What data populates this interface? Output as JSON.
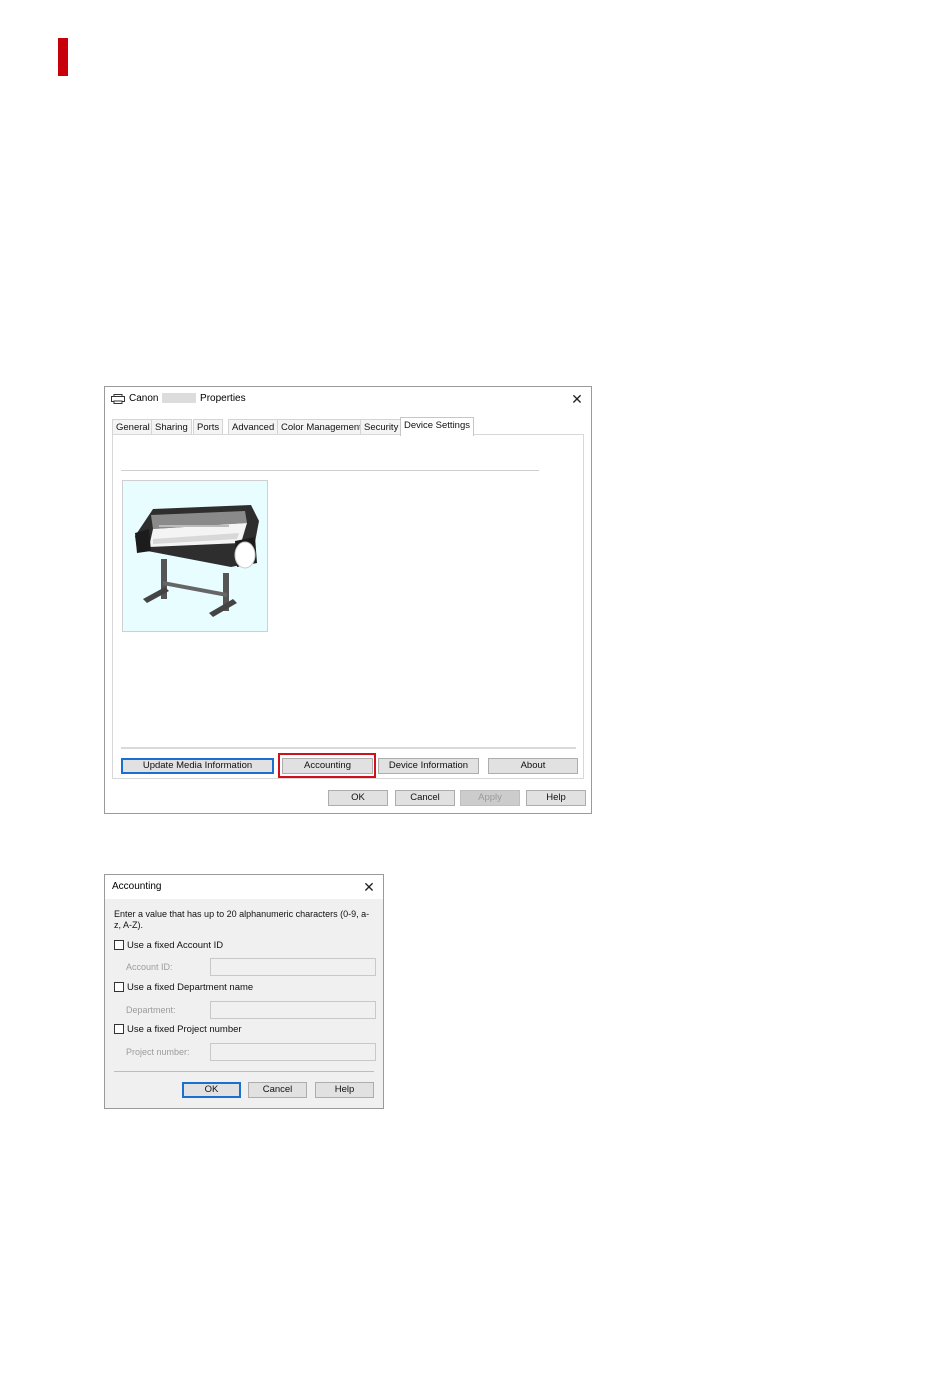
{
  "marker_color": "#c8000b",
  "properties_window": {
    "title_prefix": "Canon",
    "title_suffix": "Properties",
    "tabs": [
      "General",
      "Sharing",
      "Ports",
      "Advanced",
      "Color Management",
      "Security",
      "Device Settings"
    ],
    "active_tab": "Device Settings",
    "buttons": {
      "update_media": "Update Media Information",
      "accounting": "Accounting",
      "device_information": "Device Information",
      "about": "About"
    },
    "footer": {
      "ok": "OK",
      "cancel": "Cancel",
      "apply": "Apply",
      "help": "Help"
    },
    "highlight_color": "#d0101a"
  },
  "accounting_dialog": {
    "title": "Accounting",
    "description": "Enter a value that has up to 20 alphanumeric characters (0-9, a-z, A-Z).",
    "options": [
      {
        "checkbox": "Use a fixed Account ID",
        "field_label": "Account ID:",
        "value": "",
        "checked": false
      },
      {
        "checkbox": "Use a fixed Department name",
        "field_label": "Department:",
        "value": "",
        "checked": false
      },
      {
        "checkbox": "Use a fixed Project number",
        "field_label": "Project number:",
        "value": "",
        "checked": false
      }
    ],
    "buttons": {
      "ok": "OK",
      "cancel": "Cancel",
      "help": "Help"
    }
  }
}
